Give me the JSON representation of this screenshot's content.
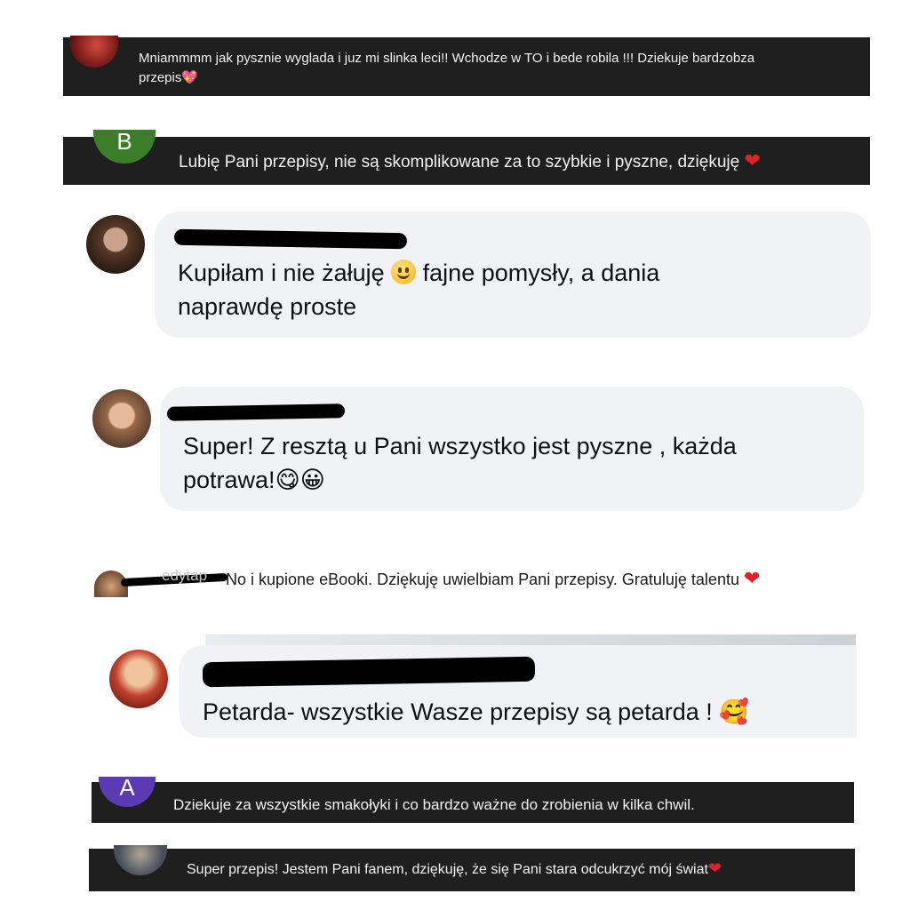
{
  "comments": [
    {
      "text": "Mniammmm jak pysznie wyglada i juz mi slinka leci!! Wchodze w TO i bede robila !!! Dziekuje bardzobza",
      "text_line2": "przepis",
      "heart": "💖",
      "avatar_icon": "profile-photo-icon"
    },
    {
      "avatar_letter": "B",
      "text": "Lubię Pani przepisy, nie są skomplikowane za to szybkie i pyszne, dziękuję",
      "heart": "❤"
    },
    {
      "text_line1": "Kupiłam i nie żałuję",
      "text_line1_after": "fajne pomysły, a dania",
      "text_line2": "naprawdę proste"
    },
    {
      "text_line1": "Super! Z resztą u Pani wszystko jest pyszne , każda",
      "text_line2": "potrawa!",
      "emojis": "😋😀"
    },
    {
      "name_fragment": "edytap",
      "text": "No i kupione eBooki. Dziękuję uwielbiam Pani przepisy. Gratuluję talentu",
      "heart": "❤"
    },
    {
      "text": "Petarda- wszystkie Wasze przepisy są petarda !",
      "emoji": "🥰"
    },
    {
      "avatar_letter": "A",
      "text": "Dziekuje za wszystkie smakołyki i co bardzo ważne do zrobienia w kilka chwil."
    },
    {
      "text": "Super przepis! Jestem Pani fanem, dziękuję, że się Pani stara odcukrzyć mój świat",
      "heart": "❤"
    }
  ],
  "colors": {
    "dark_strip": "#1f1f1f",
    "bubble": "#f0f2f5",
    "avatar_green": "#3c7d2a",
    "avatar_purple": "#5b3bb3",
    "heart_red": "#e0202a"
  }
}
